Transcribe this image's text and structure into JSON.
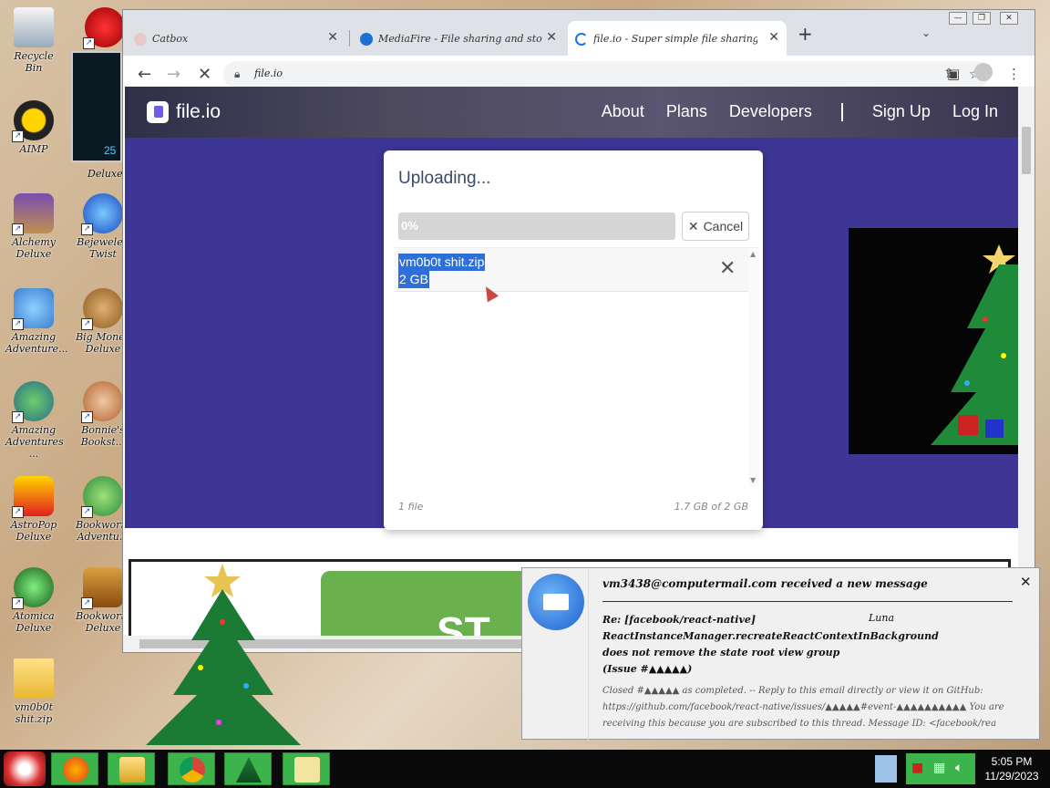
{
  "desktop": {
    "icons": [
      {
        "label": "Recycle Bin"
      },
      {
        "label": "AIMP"
      },
      {
        "label": "Alchemy Deluxe"
      },
      {
        "label": "Bejeweled Twist"
      },
      {
        "label": "Amazing Adventure..."
      },
      {
        "label": "Big Money Deluxe"
      },
      {
        "label": "Amazing Adventures ..."
      },
      {
        "label": "Bonnie's Bookst..."
      },
      {
        "label": "AstroPop Deluxe"
      },
      {
        "label": "Bookworm Adventu..."
      },
      {
        "label": "Atomica Deluxe"
      },
      {
        "label": "Bookworm Deluxe"
      },
      {
        "label": "vm0b0t shit.zip"
      },
      {
        "label": "Deluxe"
      }
    ],
    "widget_number": "25"
  },
  "browser": {
    "tabs": [
      {
        "title": "Catbox"
      },
      {
        "title": "MediaFire - File sharing and storage made simple"
      },
      {
        "title": "file.io - Super simple file sharing"
      }
    ],
    "url": "file.io"
  },
  "site": {
    "logo": "file.io",
    "nav": [
      "About",
      "Plans",
      "Developers",
      "Sign Up",
      "Log In"
    ],
    "modal": {
      "title": "Uploading...",
      "progress_label": "0%",
      "progress": 0,
      "cancel_label": "Cancel",
      "files": [
        {
          "name": "vm0b0t shit.zip",
          "size": "2 GB"
        }
      ],
      "footer_count": "1 file",
      "footer_size": "1.7 GB of 2 GB"
    },
    "ad_text": "ST"
  },
  "notification": {
    "header": "vm3438@computermail.com received a new message",
    "subject": "Re: [facebook/react-native] ReactInstanceManager.recreateReactContextInBackground does not remove the state root view group (Issue #▲▲▲▲▲)",
    "from": "Luna",
    "body": "Closed #▲▲▲▲▲ as completed. -- Reply to this email directly or view it on GitHub: https://github.com/facebook/react-native/issues/▲▲▲▲▲#event-▲▲▲▲▲▲▲▲▲▲ You are receiving this because you are subscribed to this thread. Message ID: <facebook/rea"
  },
  "taskbar": {
    "time": "5:05 PM",
    "date": "11/29/2023"
  },
  "colors": {
    "hero": "#3d3695",
    "accent": "#2f6fd8",
    "taskbar_app": "#3cb44b"
  }
}
